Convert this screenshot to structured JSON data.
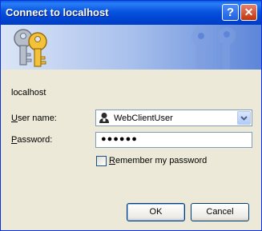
{
  "window": {
    "title": "Connect to localhost",
    "help_glyph": "?",
    "close_glyph": "✕"
  },
  "icons": {
    "banner": "keys-icon",
    "user": "user-icon",
    "dropdown": "chevron-down-icon"
  },
  "colors": {
    "titlebar": "#0054e3",
    "dialog_bg": "#ece9d8",
    "banner_end": "#5d86d9"
  },
  "form": {
    "host": "localhost",
    "user_label_accel": "U",
    "user_label_rest": "ser name:",
    "user_value": "WebClientUser",
    "pass_label_accel": "P",
    "pass_label_rest": "assword:",
    "pass_value": "●●●●●●",
    "remember_accel": "R",
    "remember_rest": "emember my password",
    "remember_checked": false
  },
  "buttons": {
    "ok": "OK",
    "cancel": "Cancel"
  }
}
